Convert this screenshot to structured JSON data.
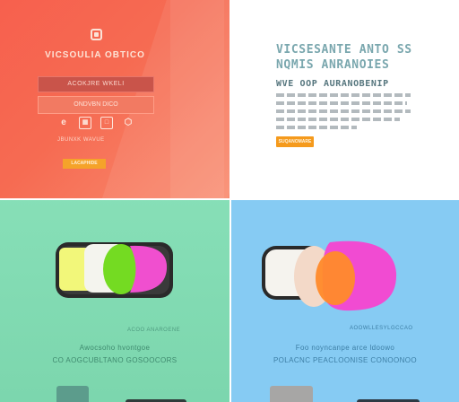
{
  "panel_top_left": {
    "title": "VICSOULIA OBTICO",
    "email_field": "ACOKJRE WKELI",
    "submit_label": "ONDVBN DICO",
    "social_icons": [
      "e-icon",
      "grid-icon",
      "square-icon",
      "cube-icon"
    ],
    "small_text": "JBUNXK WAVUE",
    "cta_label": "LACAPHIDE"
  },
  "panel_top_right": {
    "headline": "VICSESANTE ANTO SS NQMIS ANRANOIES",
    "subheadline": "WVE OOP AURANOBENIP",
    "cta_label": "SUQANOMARE"
  },
  "panel_bottom_left": {
    "caption_small": "ACOO ANAROENE",
    "caption_line1": "Awocsoho hvontgoe",
    "caption_line2": "CO AOGCUBLTANO GOSOOCORS"
  },
  "panel_bottom_right": {
    "caption_small": "AOOWLLESYLGCCAO",
    "caption_line1": "Foo noyncanpe arce ldoowo",
    "caption_line2": "POLACNC PEACLOONISE CONOONOO"
  },
  "colors": {
    "coral": "#f7604e",
    "mint": "#80ddb3",
    "sky": "#86cbf3",
    "orange_cta": "#f59a1c",
    "magenta": "#f14bd2",
    "lime": "#7fde2a"
  }
}
